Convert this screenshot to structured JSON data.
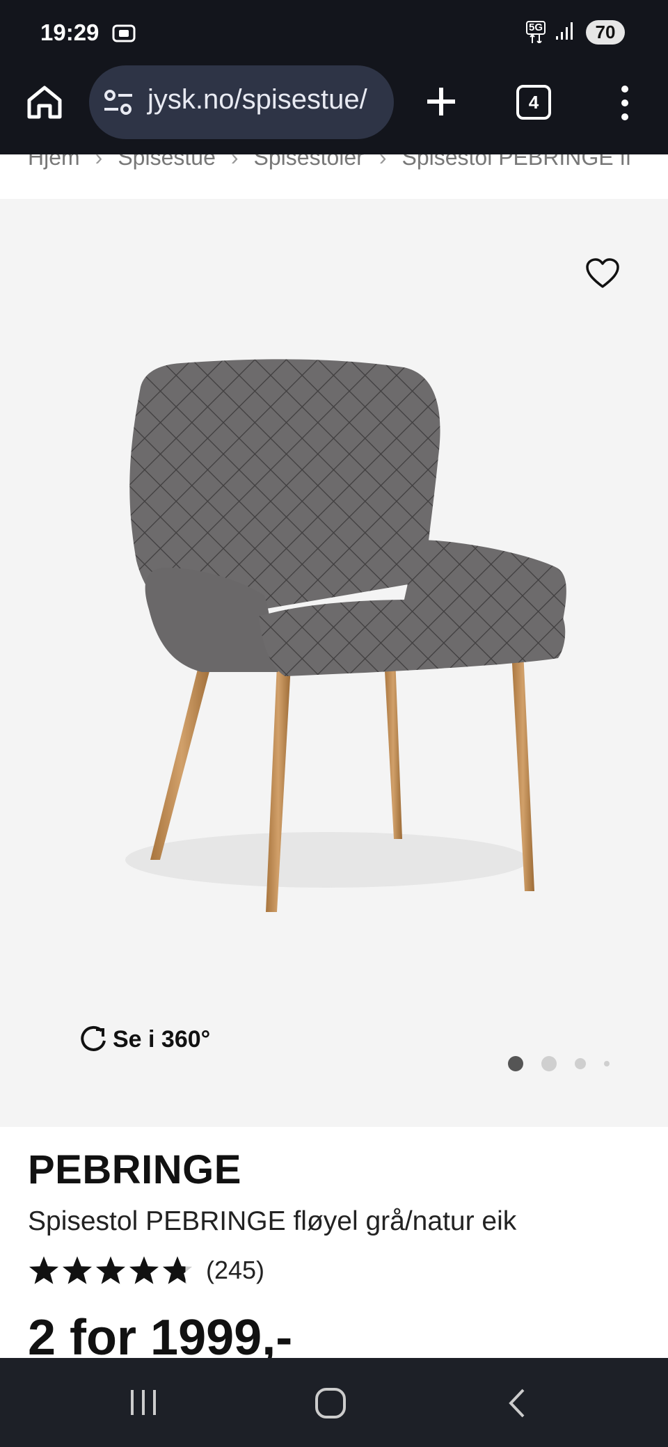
{
  "status_bar": {
    "time": "19:29",
    "network_label": "5G",
    "battery": "70"
  },
  "browser": {
    "url": "jysk.no/spisestue/",
    "tab_count": "4"
  },
  "breadcrumb": [
    "Hjem",
    "Spisestue",
    "Spisestoler",
    "Spisestol PEBRINGE fl"
  ],
  "product": {
    "view_360_label": "Se i 360°",
    "brand": "PEBRINGE",
    "name": "Spisestol PEBRINGE fløyel grå/natur eik",
    "rating": 4.8,
    "review_count": "(245)",
    "price": "2 for 1999,-",
    "image_count": 4,
    "active_image": 1
  },
  "colors": {
    "status_bg": "#13151c",
    "url_pill_bg": "#2e3446",
    "image_bg": "#f4f4f4",
    "nav_bg": "#1d2027"
  }
}
